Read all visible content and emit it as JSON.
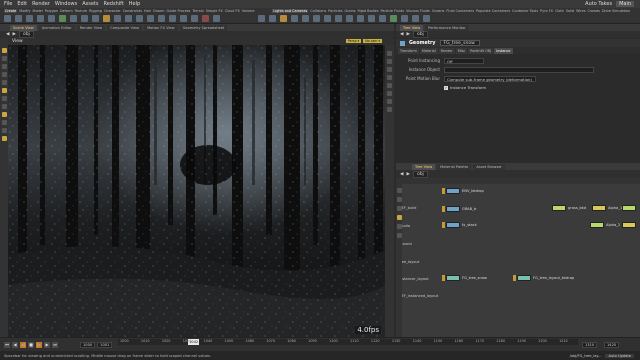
{
  "menubar": {
    "items": [
      "File",
      "Edit",
      "Render",
      "Windows",
      "Assets",
      "Redshift",
      "Help"
    ],
    "right_label": "Auto Takes",
    "main_label": "Main"
  },
  "shelf": {
    "tabs_left": [
      "Create",
      "Modify",
      "Model",
      "Polygon",
      "Deform",
      "Texture",
      "Rigging",
      "Character",
      "Constraints",
      "Hair",
      "Groom",
      "Guide Process",
      "Terrain",
      "Simple FX",
      "Cloud FX",
      "Volume"
    ],
    "tabs_right": [
      "Lights and Cameras",
      "Collisions",
      "Particles",
      "Grains",
      "Rigid Bodies",
      "Particle Fluids",
      "Viscous Fluids",
      "Oceans",
      "Fluid Containers",
      "Populate Containers",
      "Container Tools",
      "Pyro FX",
      "Cloth",
      "Solid",
      "Wires",
      "Crowds",
      "Drive Simulation"
    ]
  },
  "left_pane": {
    "tabs": [
      "Scene View",
      "Animation Editor",
      "Render View",
      "Composite View",
      "Motion FX View",
      "Geometry Spreadsheet"
    ],
    "active_tab": "Scene View",
    "path": "obj",
    "view_label": "View",
    "badges": [
      "Persp ▾",
      "No cam ▾"
    ],
    "fps": "4.0fps"
  },
  "param_pane": {
    "tabs": [
      "Tree View",
      "Performance Monitor"
    ],
    "path": "obj",
    "node_type": "Geometry",
    "node_name": "FG_tree_snow",
    "subtabs": [
      "Transform",
      "Material",
      "Render",
      "Misc",
      "Redshift OBJ",
      "Instance"
    ],
    "active_subtab": "Instance",
    "params": [
      {
        "label": "Point Instancing",
        "value": "Off"
      },
      {
        "label": "Instance Object",
        "value": ""
      },
      {
        "label": "Point Motion Blur",
        "value": "Compute sub-frame geometry (deformation)"
      }
    ],
    "checkbox": {
      "label": "Instance Transform",
      "checked": "✓"
    }
  },
  "network": {
    "tabs": [
      "Tree View",
      "Material Palette",
      "Asset Browser"
    ],
    "path": "obj",
    "labels": [
      "REF_build",
      "studio",
      "ground",
      "tree_layout",
      "instancer_layout",
      "REF_instanced_layout"
    ],
    "nodes": [
      "ENV_bkdrop",
      "GRAB_tr",
      "fx_stack",
      "FG_tree_snow",
      "FG_tree_layout_bkdrop",
      "grass_bkd",
      "Alpha_1",
      "Alpha_2"
    ]
  },
  "timeline": {
    "ticks": [
      "1000",
      "1010",
      "1020",
      "1030",
      "1040",
      "1050",
      "1060",
      "1070",
      "1080",
      "1090",
      "1100",
      "1110",
      "1120",
      "1130",
      "1140",
      "1150",
      "1160",
      "1170",
      "1180",
      "1190",
      "1200",
      "1210"
    ],
    "start": "1000",
    "current": "1001",
    "current_frame": "1042",
    "end": "1310",
    "end2": "1420"
  },
  "status": {
    "message": "Spacebar for viewing and unrestricted scrolling. Middle mouse drag on frame slider to hold scoped channel values.",
    "file": "/obj/FG_tree_lay...",
    "update_label": "Auto Update"
  }
}
